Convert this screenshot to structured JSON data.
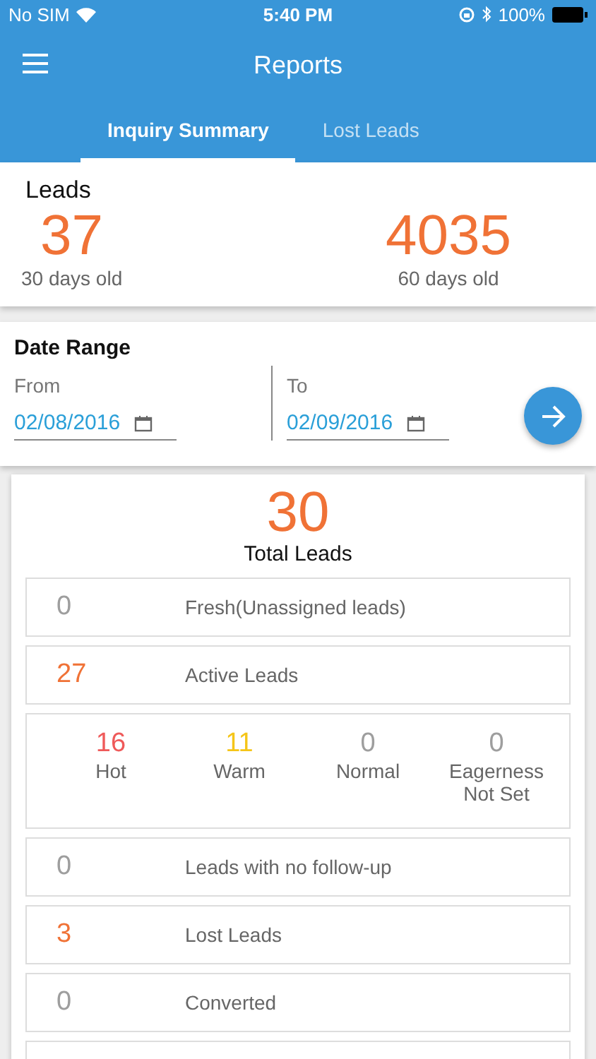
{
  "status_bar": {
    "carrier": "No SIM",
    "time": "5:40 PM",
    "battery": "100%"
  },
  "header": {
    "title": "Reports"
  },
  "tabs": [
    {
      "label": "Inquiry Summary",
      "selected": true
    },
    {
      "label": "Lost Leads",
      "selected": false
    }
  ],
  "leads": {
    "title": "Leads",
    "stats": [
      {
        "value": "37",
        "label": "30 days old"
      },
      {
        "value": "4035",
        "label": "60 days old"
      }
    ]
  },
  "date_range": {
    "title": "Date Range",
    "from": {
      "label": "From",
      "value": "02/08/2016"
    },
    "to": {
      "label": "To",
      "value": "02/09/2016"
    }
  },
  "summary": {
    "total": "30",
    "total_label": "Total Leads",
    "rows": [
      {
        "kind": "count",
        "value": "0",
        "label": "Fresh(Unassigned leads)",
        "color": "#9e9e9e"
      },
      {
        "kind": "count",
        "value": "27",
        "label": "Active Leads",
        "color": "#f07236"
      },
      {
        "kind": "eagerness",
        "items": [
          {
            "value": "16",
            "label": "Hot",
            "color": "#ef5a5a"
          },
          {
            "value": "11",
            "label": "Warm",
            "color": "#f5c518"
          },
          {
            "value": "0",
            "label": "Normal",
            "color": "#9e9e9e"
          },
          {
            "value": "0",
            "label": "Eagerness Not Set",
            "color": "#9e9e9e"
          }
        ]
      },
      {
        "kind": "count",
        "value": "0",
        "label": "Leads with no follow-up",
        "color": "#9e9e9e"
      },
      {
        "kind": "count",
        "value": "3",
        "label": "Lost Leads",
        "color": "#f07236"
      },
      {
        "kind": "count",
        "value": "0",
        "label": "Converted",
        "color": "#9e9e9e"
      }
    ]
  }
}
